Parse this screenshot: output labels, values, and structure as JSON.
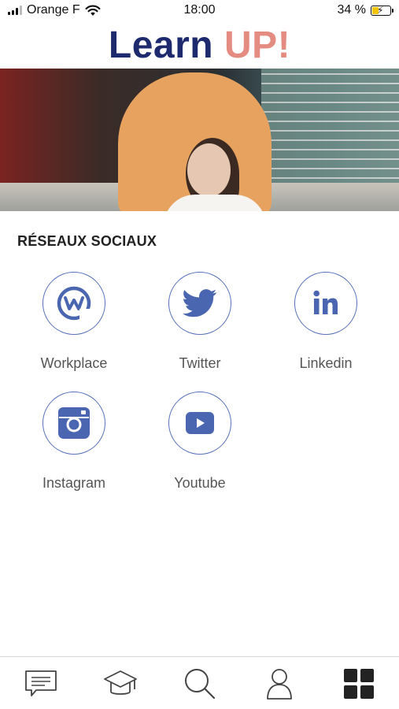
{
  "status_bar": {
    "carrier": "Orange F",
    "time": "18:00",
    "battery_percent": "34 %",
    "battery_level": 0.34
  },
  "header": {
    "title_part1": "Learn",
    "title_part2": "UP!",
    "colors": {
      "part1": "#1d2a6e",
      "part2": "#e48c82"
    }
  },
  "section": {
    "title": "RÉSEAUX SOCIAUX"
  },
  "social_links": [
    {
      "label": "Workplace",
      "icon": "workplace-icon"
    },
    {
      "label": "Twitter",
      "icon": "twitter-icon"
    },
    {
      "label": "Linkedin",
      "icon": "linkedin-icon"
    },
    {
      "label": "Instagram",
      "icon": "instagram-icon"
    },
    {
      "label": "Youtube",
      "icon": "youtube-icon"
    }
  ],
  "accent_color": "#5572b8",
  "bottom_nav": [
    {
      "icon": "messages-icon"
    },
    {
      "icon": "graduation-cap-icon"
    },
    {
      "icon": "search-icon"
    },
    {
      "icon": "profile-icon"
    },
    {
      "icon": "apps-grid-icon",
      "active": true
    }
  ]
}
